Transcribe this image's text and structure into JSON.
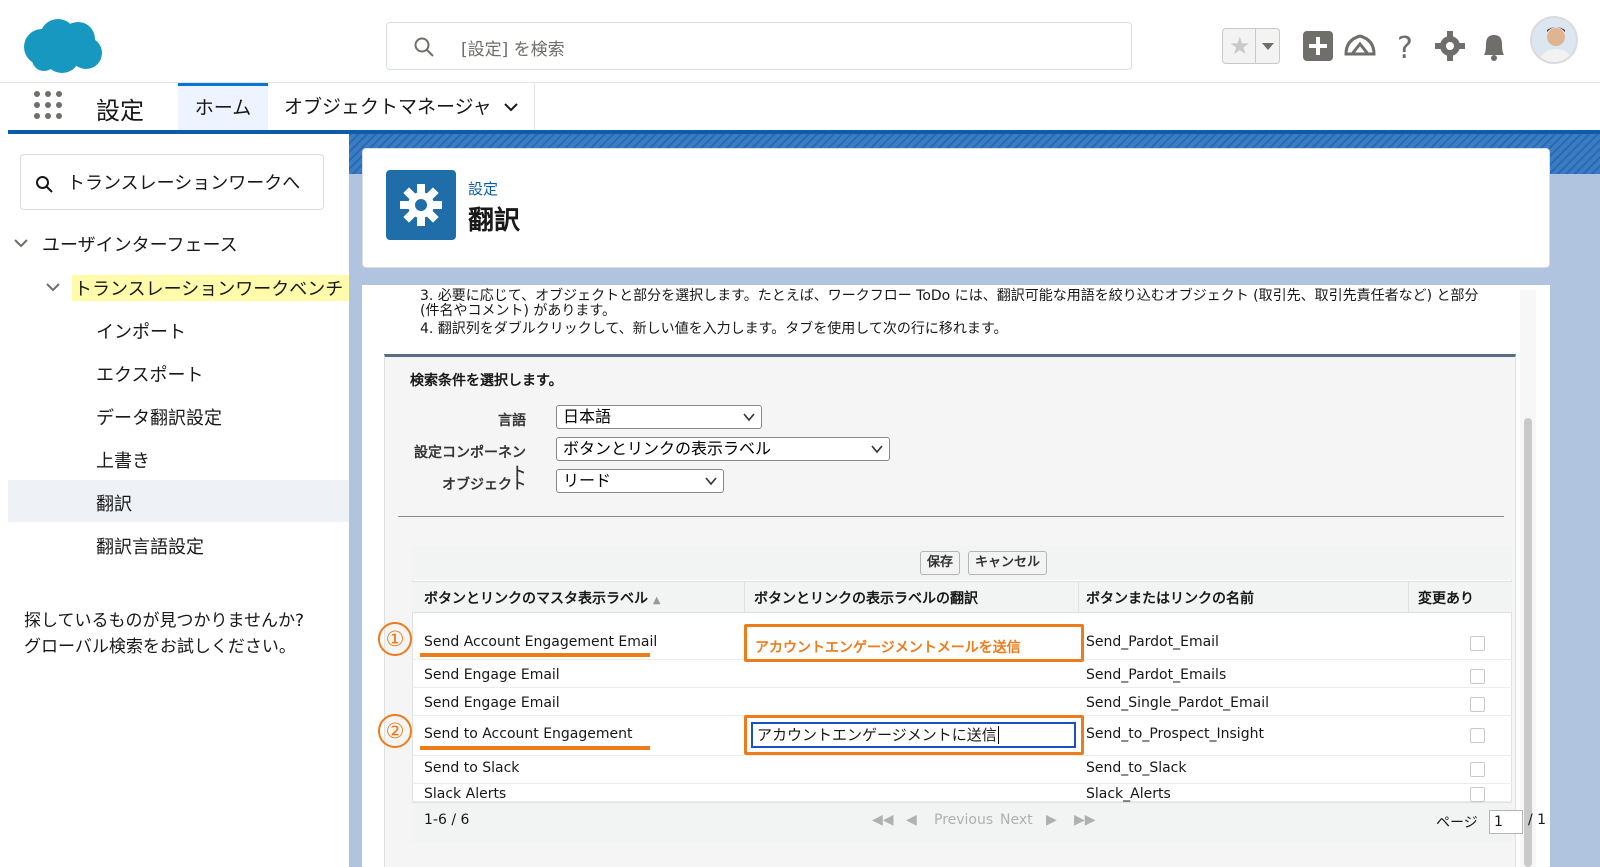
{
  "header": {
    "search_placeholder": "[設定] を検索",
    "avatar_alt": "user"
  },
  "app_nav": {
    "app_name": "設定",
    "tabs": [
      {
        "label": "ホーム"
      },
      {
        "label": "オブジェクトマネージャ"
      }
    ]
  },
  "sidebar": {
    "quick_find_value": "トランスレーションワークへ",
    "group_label": "ユーザインターフェース",
    "subgroup_label": "トランスレーションワークベンチ",
    "items": [
      {
        "label": "インポート"
      },
      {
        "label": "エクスポート"
      },
      {
        "label": "データ翻訳設定"
      },
      {
        "label": "上書き"
      },
      {
        "label": "翻訳"
      },
      {
        "label": "翻訳言語設定"
      }
    ],
    "help_line1": "探しているものが見つかりませんか?",
    "help_line2": "グローバル検索をお試しください。"
  },
  "page": {
    "breadcrumb": "設定",
    "title": "翻訳",
    "instruction_3a": "3. 必要に応じて、オブジェクトと部分を選択します。たとえば、ワークフロー ToDo には、翻訳可能な用語を絞り込むオブジェクト (取引先、取引先責任者など) と部分",
    "instruction_3b": "(件名やコメント) があります。",
    "instruction_4": "4. 翻訳列をダブルクリックして、新しい値を入力します。タブを使用して次の行に移れます。"
  },
  "criteria": {
    "title": "検索条件を選択します。",
    "language_label": "言語",
    "language_value": "日本語",
    "component_label": "設定コンポーネント",
    "component_value": "ボタンとリンクの表示ラベル",
    "object_label": "オブジェクト",
    "object_value": "リード"
  },
  "table": {
    "save_label": "保存",
    "cancel_label": "キャンセル",
    "columns": [
      "ボタンとリンクのマスタ表示ラベル",
      "ボタンとリンクの表示ラベルの翻訳",
      "ボタンまたはリンクの名前",
      "変更あり"
    ],
    "rows": [
      {
        "master": "Send Account Engagement Email",
        "translation": "アカウントエンゲージメントメールを送信",
        "name": "Send_Pardot_Email",
        "changed": false
      },
      {
        "master": "Send Engage Email",
        "translation": "",
        "name": "Send_Pardot_Emails",
        "changed": false
      },
      {
        "master": "Send Engage Email",
        "translation": "",
        "name": "Send_Single_Pardot_Email",
        "changed": false
      },
      {
        "master": "Send to Account Engagement",
        "translation": "アカウントエンゲージメントに送信",
        "name": "Send_to_Prospect_Insight",
        "changed": false
      },
      {
        "master": "Send to Slack",
        "translation": "",
        "name": "Send_to_Slack",
        "changed": false
      },
      {
        "master": "Slack Alerts",
        "translation": "",
        "name": "Slack_Alerts",
        "changed": false
      }
    ],
    "callouts": [
      "①",
      "②"
    ],
    "pager": {
      "range": "1-6 / 6",
      "previous": "Previous",
      "next": "Next",
      "page_label": "ページ",
      "page_value": "1",
      "page_total": "/ 1"
    }
  },
  "colors": {
    "brand_blue": "#0b5cab",
    "setup_icon": "#1f6ea9",
    "annotation_orange": "#ec7c1c",
    "highlight_yellow": "#fffbab"
  }
}
